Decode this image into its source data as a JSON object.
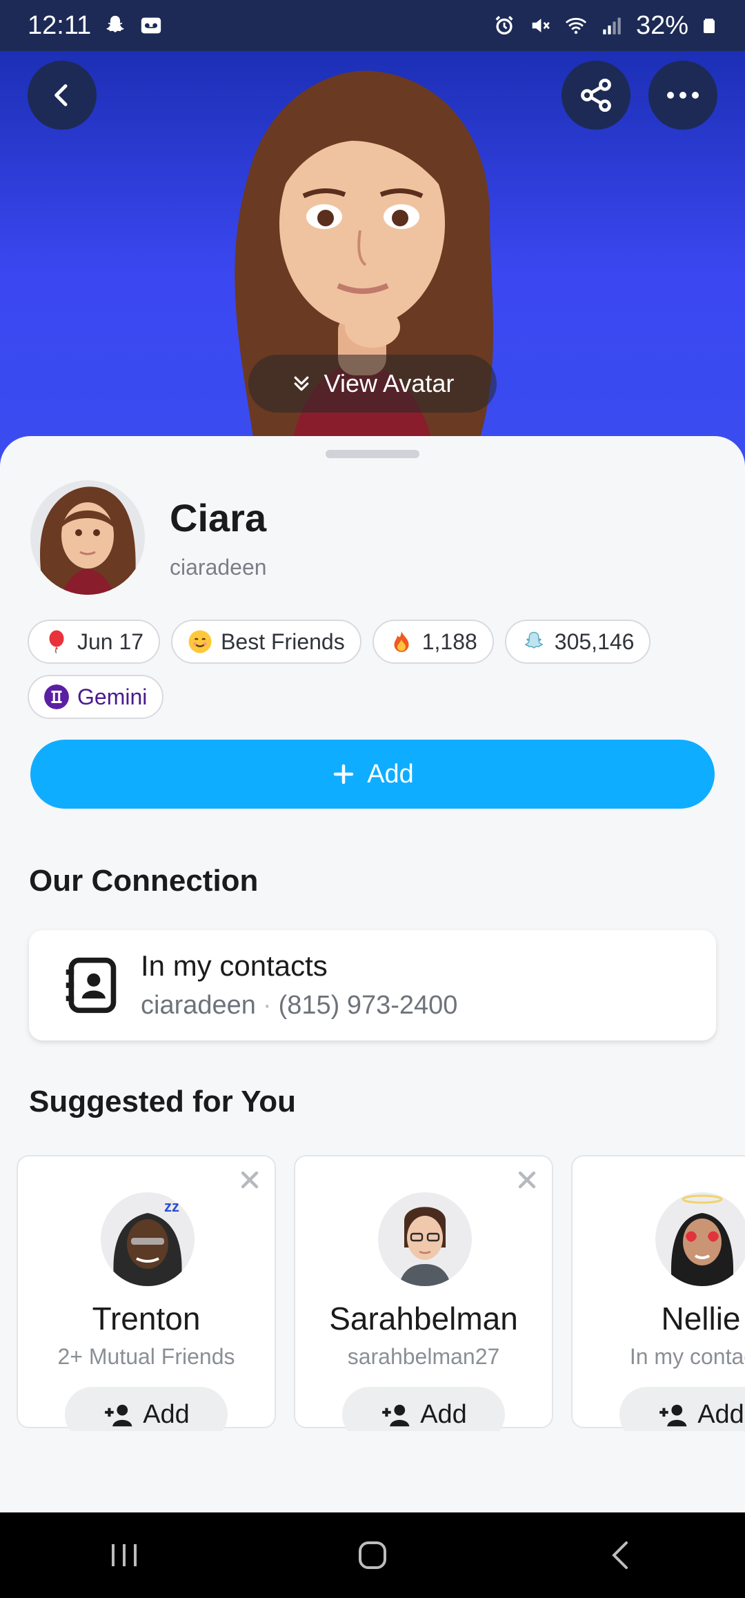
{
  "status_bar": {
    "time": "12:11",
    "battery": "32%",
    "icons_left": [
      "snapchat-ghost-icon",
      "voicemail-icon"
    ],
    "icons_right": [
      "alarm-icon",
      "mute-icon",
      "wifi-icon",
      "signal-icon",
      "battery-icon"
    ]
  },
  "hero": {
    "back_icon": "back-arrow-icon",
    "share_icon": "share-icon",
    "more_icon": "more-icon",
    "view_avatar_label": "View Avatar"
  },
  "profile": {
    "name": "Ciara",
    "username": "ciaradeen"
  },
  "chips": [
    {
      "label": "Jun 17",
      "icon": "balloon-icon"
    },
    {
      "label": "Best Friends",
      "icon": "smile-emoji-icon"
    },
    {
      "label": "1,188",
      "icon": "fire-emoji-icon"
    },
    {
      "label": "305,146",
      "icon": "snap-score-icon"
    },
    {
      "label": "Gemini",
      "icon": "gemini-icon"
    }
  ],
  "add_button": {
    "label": "Add"
  },
  "connection": {
    "title": "Our Connection",
    "card_title": "In my contacts",
    "card_username": "ciaradeen",
    "card_phone": "(815) 973-2400"
  },
  "suggested": {
    "title": "Suggested for You",
    "items": [
      {
        "name": "Trenton",
        "sub": "2+ Mutual Friends",
        "add_label": "Add"
      },
      {
        "name": "Sarahbelman",
        "sub": "sarahbelman27",
        "add_label": "Add"
      },
      {
        "name": "Nellie",
        "sub": "In my contacts",
        "add_label": "Add"
      }
    ]
  },
  "colors": {
    "accent": "#0fadff",
    "hero_blue": "#3b48f2",
    "status_bar": "#1c2a55"
  }
}
